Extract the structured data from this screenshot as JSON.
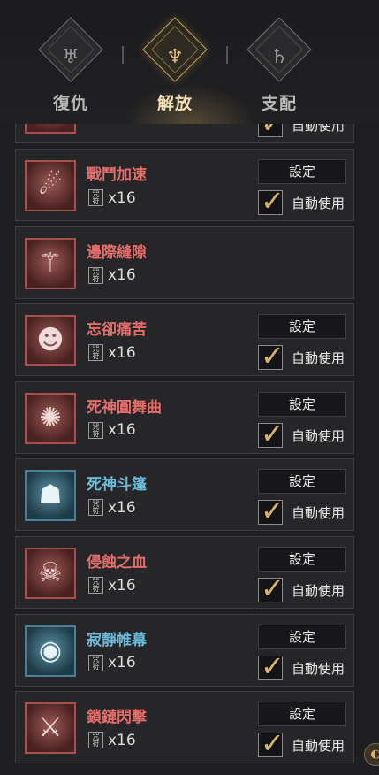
{
  "tabs": [
    {
      "label": "復仇",
      "icon": "demon-crest-icon",
      "glyph": "♅",
      "active": false
    },
    {
      "label": "解放",
      "icon": "liberation-crest-icon",
      "glyph": "♆",
      "active": true
    },
    {
      "label": "支配",
      "icon": "dominion-crest-icon",
      "glyph": "♄",
      "active": false
    }
  ],
  "accent_color": "#c9a45a",
  "common": {
    "set_label": "設定",
    "auto_label": "自動使用",
    "count_badge": "咒符",
    "check_glyph": "✓"
  },
  "partial_row": {
    "auto_label": "自動使用",
    "check_glyph": "✓"
  },
  "items": [
    {
      "name": "戰鬥加速",
      "count": "x16",
      "color": "red",
      "icon": "battle-haste-icon",
      "glyph": "☄",
      "has_setting": true,
      "auto_use": true
    },
    {
      "name": "邊際縫隙",
      "count": "x16",
      "color": "red",
      "icon": "edge-rift-icon",
      "glyph": "⚚",
      "has_setting": false,
      "auto_use": false
    },
    {
      "name": "忘卻痛苦",
      "count": "x16",
      "color": "red",
      "icon": "forget-pain-icon",
      "glyph": "☻",
      "has_setting": true,
      "auto_use": true
    },
    {
      "name": "死神圓舞曲",
      "count": "x16",
      "color": "red",
      "icon": "death-waltz-icon",
      "glyph": "✺",
      "has_setting": true,
      "auto_use": true
    },
    {
      "name": "死神斗篷",
      "count": "x16",
      "color": "blue",
      "icon": "death-cloak-icon",
      "glyph": "☗",
      "has_setting": true,
      "auto_use": true
    },
    {
      "name": "侵蝕之血",
      "count": "x16",
      "color": "red",
      "icon": "corrosive-blood-icon",
      "glyph": "☠",
      "has_setting": true,
      "auto_use": true
    },
    {
      "name": "寂靜帷幕",
      "count": "x16",
      "color": "blue",
      "icon": "silent-veil-icon",
      "glyph": "◉",
      "has_setting": true,
      "auto_use": true
    },
    {
      "name": "鎖鏈閃擊",
      "count": "x16",
      "color": "red",
      "icon": "chain-strike-icon",
      "glyph": "⚔",
      "has_setting": true,
      "auto_use": true
    }
  ],
  "corner_button": {
    "icon": "menu-orb-icon",
    "glyph": "◐"
  }
}
